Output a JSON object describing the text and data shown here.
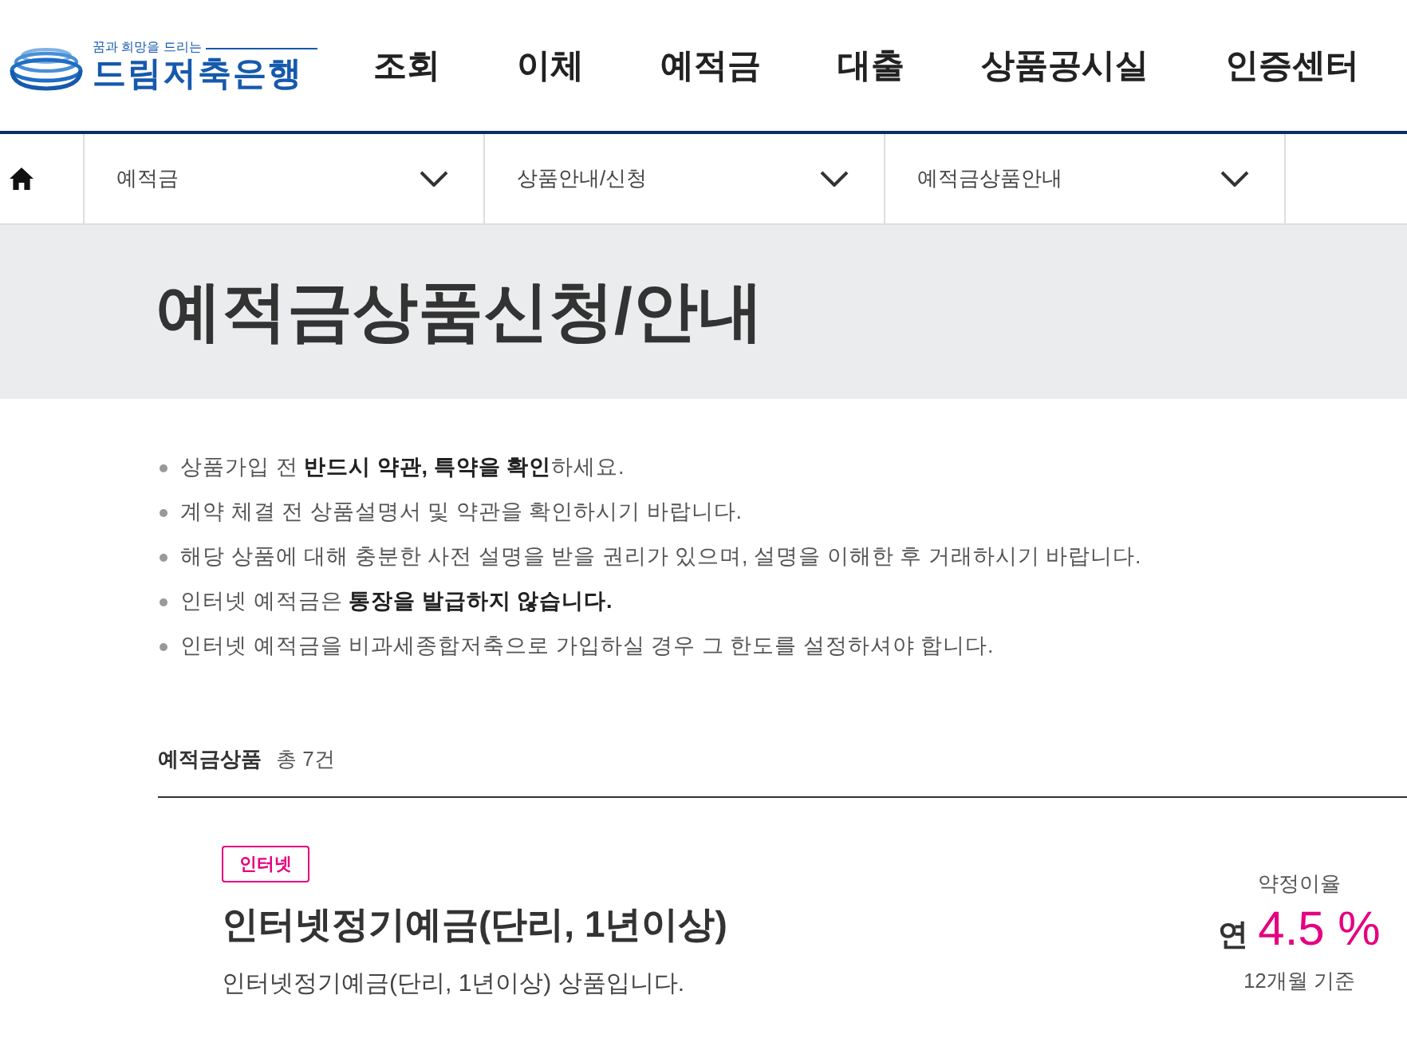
{
  "header": {
    "logo": {
      "tagline": "꿈과 희망을 드리는",
      "name": "드림저축은행"
    },
    "nav": [
      "조회",
      "이체",
      "예적금",
      "대출",
      "상품공시실",
      "인증센터"
    ]
  },
  "breadcrumb": [
    "예적금",
    "상품안내/신청",
    "예적금상품안내"
  ],
  "page_title": "예적금상품신청/안내",
  "notices": [
    "상품가입 전 **반드시 약관, 특약을 확인**하세요.",
    "계약 체결 전 상품설명서 및 약관을 확인하시기 바랍니다.",
    "해당 상품에 대해 충분한 사전 설명을 받을 권리가 있으며, 설명을 이해한 후 거래하시기 바랍니다.",
    "인터넷 예적금은 **통장을 발급하지 않습니다.**",
    "인터넷 예적금을 비과세종합저축으로 가입하실 경우 그 한도를 설정하셔야 합니다."
  ],
  "product_list": {
    "title": "예적금상품",
    "count": "총 7건",
    "products": [
      {
        "tag": "인터넷",
        "name": "인터넷정기예금(단리, 1년이상)",
        "description": "인터넷정기예금(단리, 1년이상) 상품입니다.",
        "rate_label": "약정이율",
        "rate_prefix": "연",
        "rate": "4.5 %",
        "rate_basis": "12개월 기준"
      }
    ]
  }
}
